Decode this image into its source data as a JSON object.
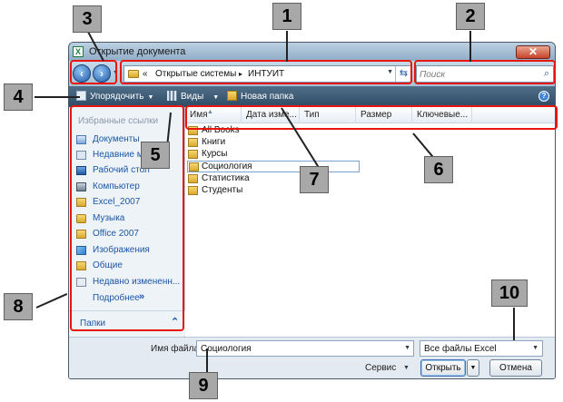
{
  "window": {
    "title": "Открытие документа",
    "app_icon_letter": "X",
    "close_symbol": "✕"
  },
  "nav": {
    "back_symbol": "‹",
    "forward_symbol": "›"
  },
  "address_bar": {
    "prefix": "«",
    "breadcrumbs": [
      "Открытые системы",
      "ИНТУИТ"
    ],
    "separator": "▸"
  },
  "search": {
    "placeholder": "Поиск"
  },
  "toolbar": {
    "organize_label": "Упорядочить",
    "views_label": "Виды",
    "new_folder_label": "Новая папка"
  },
  "left_pane": {
    "favorites_heading": "Избранные ссылки",
    "links": [
      {
        "label": "Документы",
        "icon": "documents-icon"
      },
      {
        "label": "Недавние ме",
        "icon": "recent-places-icon"
      },
      {
        "label": "Рабочий стол",
        "icon": "desktop-icon"
      },
      {
        "label": "Компьютер",
        "icon": "computer-icon"
      },
      {
        "label": "Excel_2007",
        "icon": "folder-icon"
      },
      {
        "label": "Музыка",
        "icon": "music-icon"
      },
      {
        "label": "Office 2007",
        "icon": "folder-icon"
      },
      {
        "label": "Изображения",
        "icon": "pictures-icon"
      },
      {
        "label": "Общие",
        "icon": "folder-icon"
      },
      {
        "label": "Недавно измененн...",
        "icon": "recently-changed-icon"
      }
    ],
    "more_label": "Подробнее",
    "more_symbol": "»",
    "folders_label": "Папки",
    "folders_symbol": "⌃"
  },
  "columns": [
    "Имя",
    "Дата изме...",
    "Тип",
    "Размер",
    "Ключевые..."
  ],
  "files": [
    "All Books",
    "Книги",
    "Курсы",
    "Социология",
    "Статистика",
    "Студенты"
  ],
  "selected_file": "Социология",
  "bottom": {
    "filename_label": "Имя файла:",
    "filename_value": "Социология",
    "filetype_value": "Все файлы Excel",
    "service_label": "Сервис",
    "open_label": "Открыть",
    "cancel_label": "Отмена"
  },
  "callouts": [
    "1",
    "2",
    "3",
    "4",
    "5",
    "6",
    "7",
    "8",
    "9",
    "10"
  ],
  "colors": {
    "callout_border": "#e8160e",
    "callout_box": "#a8a8a8",
    "toolbar_bg": "#3d5b76",
    "link_text": "#1b56a5"
  }
}
